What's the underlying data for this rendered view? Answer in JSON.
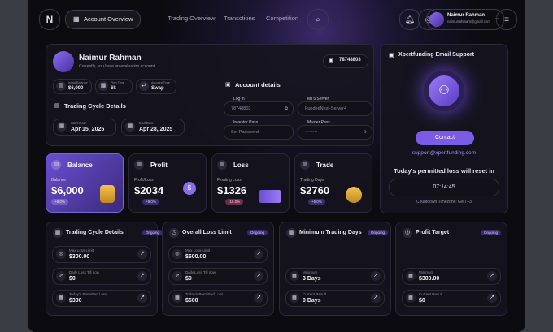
{
  "nav": {
    "tabs": [
      "Account Overview",
      "Trading Overview",
      "Transctions",
      "Competition"
    ],
    "user_name": "Naimur Rahman",
    "user_email": "naimurrahmam@gmail.com"
  },
  "profile": {
    "name": "Naimur Rahman",
    "subtitle": "Currently, you have an evaluation account",
    "account_id": "78748803",
    "stats": [
      {
        "label": "Initial Balance",
        "value": "$6,000"
      },
      {
        "label": "Plan Type",
        "value": "6k"
      },
      {
        "label": "Account Type",
        "value": "Swap"
      }
    ],
    "cycle_title": "Trading Cycle Details",
    "start_label": "Start Date",
    "start_value": "Apr 15, 2025",
    "end_label": "End Date",
    "end_value": "Apr 28, 2025"
  },
  "account_details": {
    "title": "Account details",
    "login_label": "Log in",
    "login_value": "78748803",
    "server_label": "MT5 Server",
    "server_value": "FundedNext-Server4",
    "investor_label": "Investor Pass",
    "investor_placeholder": "Set Password",
    "master_label": "Master Pass",
    "master_value": "••••••••"
  },
  "support": {
    "title": "Xpertfunding Email Support",
    "contact_label": "Contact",
    "email": "support@xpertfunding.com",
    "reset_text": "Today's permitted loss will reset in",
    "countdown": "07:14:45",
    "timezone": "Countdown Timezone: GMT+3"
  },
  "metrics": [
    {
      "title": "Balance",
      "sub": "Balance",
      "value": "$6,000",
      "badge": "+6.0%"
    },
    {
      "title": "Profit",
      "sub": "Profit/Loss",
      "value": "$2034",
      "badge": "+8.0%"
    },
    {
      "title": "Loss",
      "sub": "Floating Loss",
      "value": "$1326",
      "badge": "-15.0%"
    },
    {
      "title": "Trade",
      "sub": "Trading Days",
      "value": "$2760",
      "badge": "+6.0%"
    }
  ],
  "bottom": [
    {
      "title": "Trading Cycle Details",
      "badge": "Ongoing",
      "rows": [
        {
          "label": "Max Loss Limit",
          "value": "$300.00"
        },
        {
          "label": "Daily Loss Till now",
          "value": "$0"
        },
        {
          "label": "Today's Permitted Loss",
          "value": "$300"
        }
      ]
    },
    {
      "title": "Overall Loss Limit",
      "badge": "Ongoing",
      "rows": [
        {
          "label": "Max Loss Limit",
          "value": "$600.00"
        },
        {
          "label": "Daily Loss Till now",
          "value": "$0"
        },
        {
          "label": "Today's Permitted Loss",
          "value": "$600"
        }
      ]
    },
    {
      "title": "Minimum Trading Days",
      "badge": "Ongoing",
      "rows": [
        {
          "label": "Minimum",
          "value": "3 Days"
        },
        {
          "label": "Current Result",
          "value": "0 Days"
        }
      ]
    },
    {
      "title": "Profit Target",
      "badge": "Ongoing",
      "rows": [
        {
          "label": "Minimum",
          "value": "$300.00"
        },
        {
          "label": "Current Result",
          "value": "$0"
        }
      ]
    }
  ]
}
